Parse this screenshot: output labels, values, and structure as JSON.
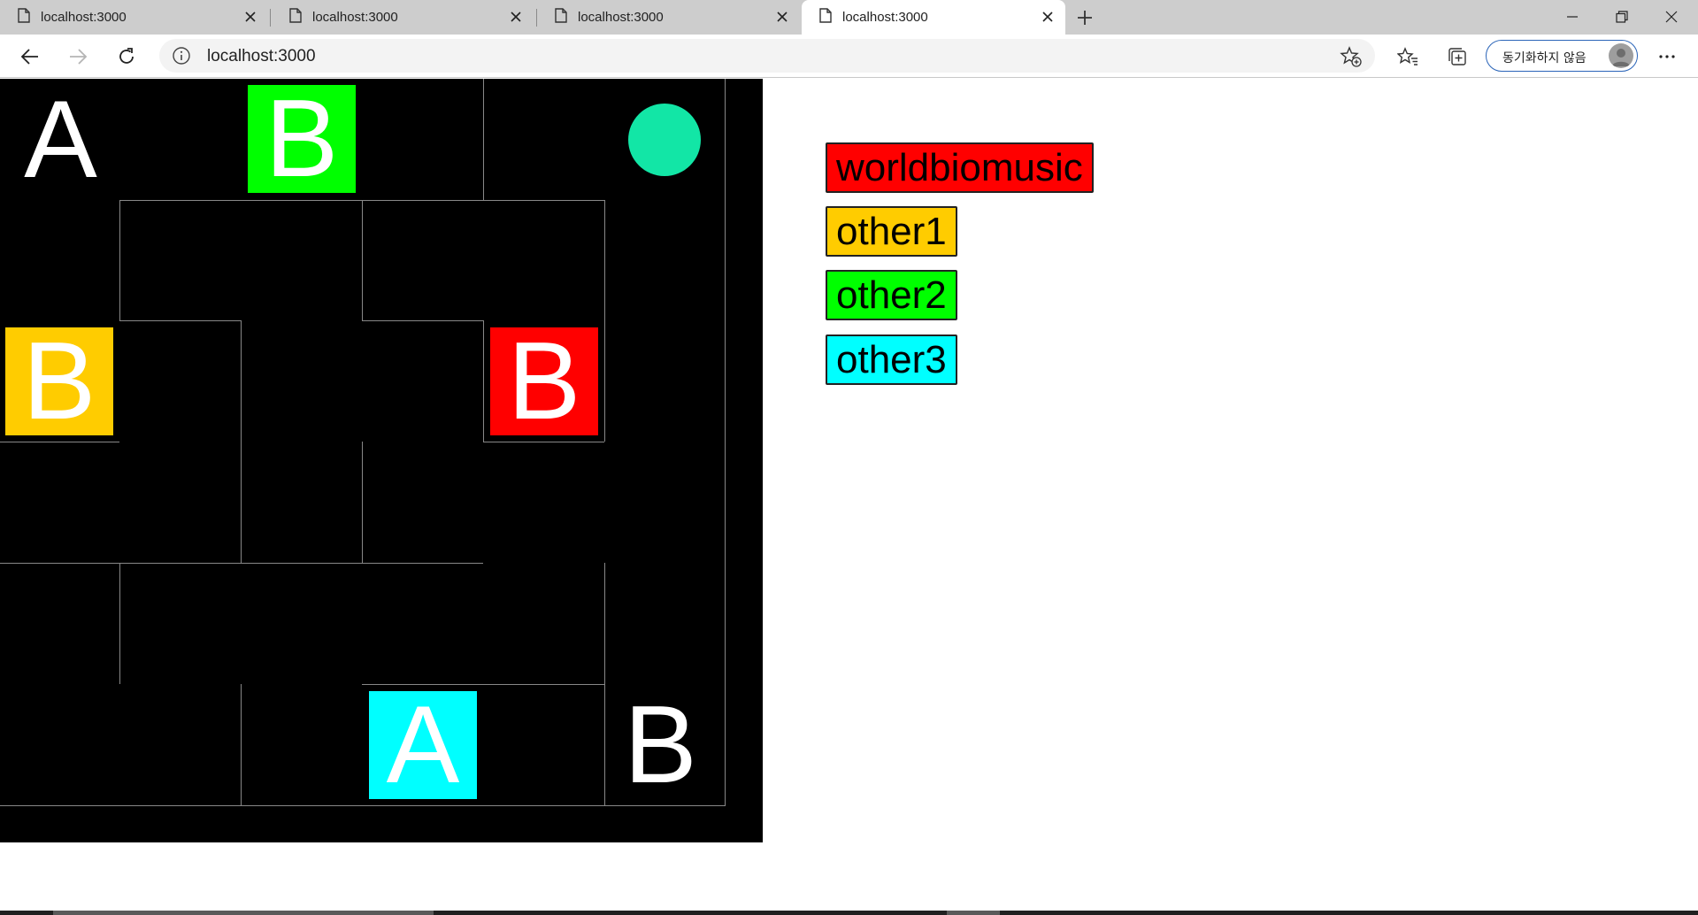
{
  "browser": {
    "tabs": [
      {
        "title": "localhost:3000",
        "active": false
      },
      {
        "title": "localhost:3000",
        "active": false
      },
      {
        "title": "localhost:3000",
        "active": false
      },
      {
        "title": "localhost:3000",
        "active": true
      }
    ],
    "address": "localhost:3000",
    "profile_label": "동기화하지 않음"
  },
  "game": {
    "grid": {
      "rows": 6,
      "cols": 6
    },
    "cells": [
      {
        "row": 0,
        "col": 0,
        "letter": "A",
        "color": null
      },
      {
        "row": 0,
        "col": 2,
        "letter": "B",
        "color": "#00ff00"
      },
      {
        "row": 2,
        "col": 0,
        "letter": "B",
        "color": "#ffcc00"
      },
      {
        "row": 2,
        "col": 4,
        "letter": "B",
        "color": "#ff0000"
      },
      {
        "row": 5,
        "col": 3,
        "letter": "A",
        "color": "#00ffff"
      },
      {
        "row": 5,
        "col": 5,
        "letter": "B",
        "color": null
      }
    ],
    "player": {
      "row": 0,
      "col": 5,
      "color": "#12e6a6"
    }
  },
  "legend": [
    {
      "label": "worldbiomusic",
      "color": "#ff0000"
    },
    {
      "label": "other1",
      "color": "#ffcc00"
    },
    {
      "label": "other2",
      "color": "#00ff00"
    },
    {
      "label": "other3",
      "color": "#00ffff"
    }
  ]
}
